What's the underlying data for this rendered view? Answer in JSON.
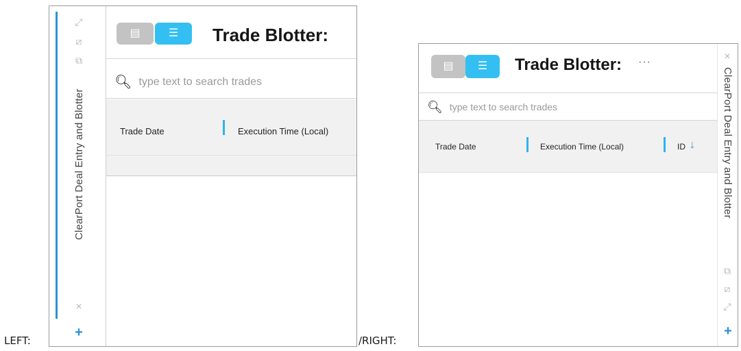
{
  "captions": {
    "left": "LEFT:",
    "right": "/RIGHT:"
  },
  "panel": {
    "title": "Trade Blotter:",
    "more_label": "···",
    "search_placeholder": "type text to search trades",
    "columns": [
      "Trade Date",
      "Execution Time (Local)",
      "ID"
    ],
    "sort_column": "ID",
    "sort_direction": "descending"
  },
  "dock": {
    "vertical_title": "ClearPort Deal Entry and Blotter",
    "add_label": "+",
    "close_label": "×"
  },
  "icons": {
    "expand": "expand-icon",
    "popout": "popout-icon",
    "restore": "restore-icon",
    "close": "close-icon",
    "add": "plus-icon",
    "deal_entry": "deal-entry-icon",
    "list_view": "list-icon",
    "search": "search-icon",
    "sort": "sort-down-arrow-icon"
  },
  "colors": {
    "accent": "#2a92d6",
    "active_button": "#34bff2",
    "inactive_button": "#c3c3c3",
    "column_separator": "#2bb5ee",
    "header_bg": "#f1f1f1"
  }
}
